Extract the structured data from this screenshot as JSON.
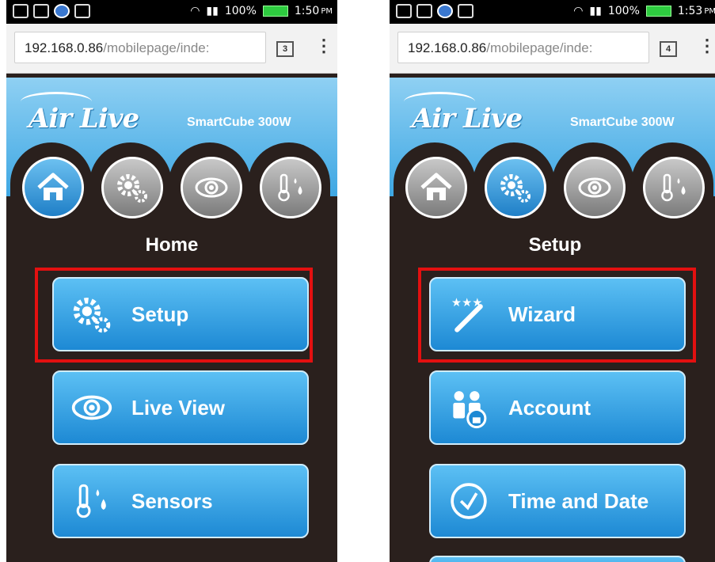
{
  "screens": [
    {
      "status": {
        "battery": "100%",
        "time": "1:50",
        "ampm": "PM"
      },
      "browser": {
        "url_host": "192.168.0.86",
        "url_path": "/mobilepage/inde:",
        "tab_count": "3"
      },
      "header": {
        "brand": "Air Live",
        "product": "SmartCube 300W"
      },
      "nav": [
        {
          "icon": "home-icon",
          "active": true
        },
        {
          "icon": "gears-icon",
          "active": false
        },
        {
          "icon": "eye-icon",
          "active": false
        },
        {
          "icon": "thermometer-drops-icon",
          "active": false
        }
      ],
      "title": "Home",
      "items": [
        {
          "label": "Setup",
          "icon": "gears-icon",
          "highlighted": true
        },
        {
          "label": "Live View",
          "icon": "eye-icon",
          "highlighted": false
        },
        {
          "label": "Sensors",
          "icon": "thermometer-drops-icon",
          "highlighted": false
        }
      ]
    },
    {
      "status": {
        "battery": "100%",
        "time": "1:53",
        "ampm": "PM"
      },
      "browser": {
        "url_host": "192.168.0.86",
        "url_path": "/mobilepage/inde:",
        "tab_count": "4"
      },
      "header": {
        "brand": "Air Live",
        "product": "SmartCube 300W"
      },
      "nav": [
        {
          "icon": "home-icon",
          "active": false
        },
        {
          "icon": "gears-icon",
          "active": true
        },
        {
          "icon": "eye-icon",
          "active": false
        },
        {
          "icon": "thermometer-drops-icon",
          "active": false
        }
      ],
      "title": "Setup",
      "items": [
        {
          "label": "Wizard",
          "icon": "magic-wand-icon",
          "highlighted": true
        },
        {
          "label": "Account",
          "icon": "users-lock-icon",
          "highlighted": false
        },
        {
          "label": "Time and Date",
          "icon": "clock-icon",
          "highlighted": false
        }
      ]
    }
  ],
  "colors": {
    "accent_blue": "#1d89d4",
    "highlight_red": "#e31010",
    "background": "#2a201d"
  }
}
